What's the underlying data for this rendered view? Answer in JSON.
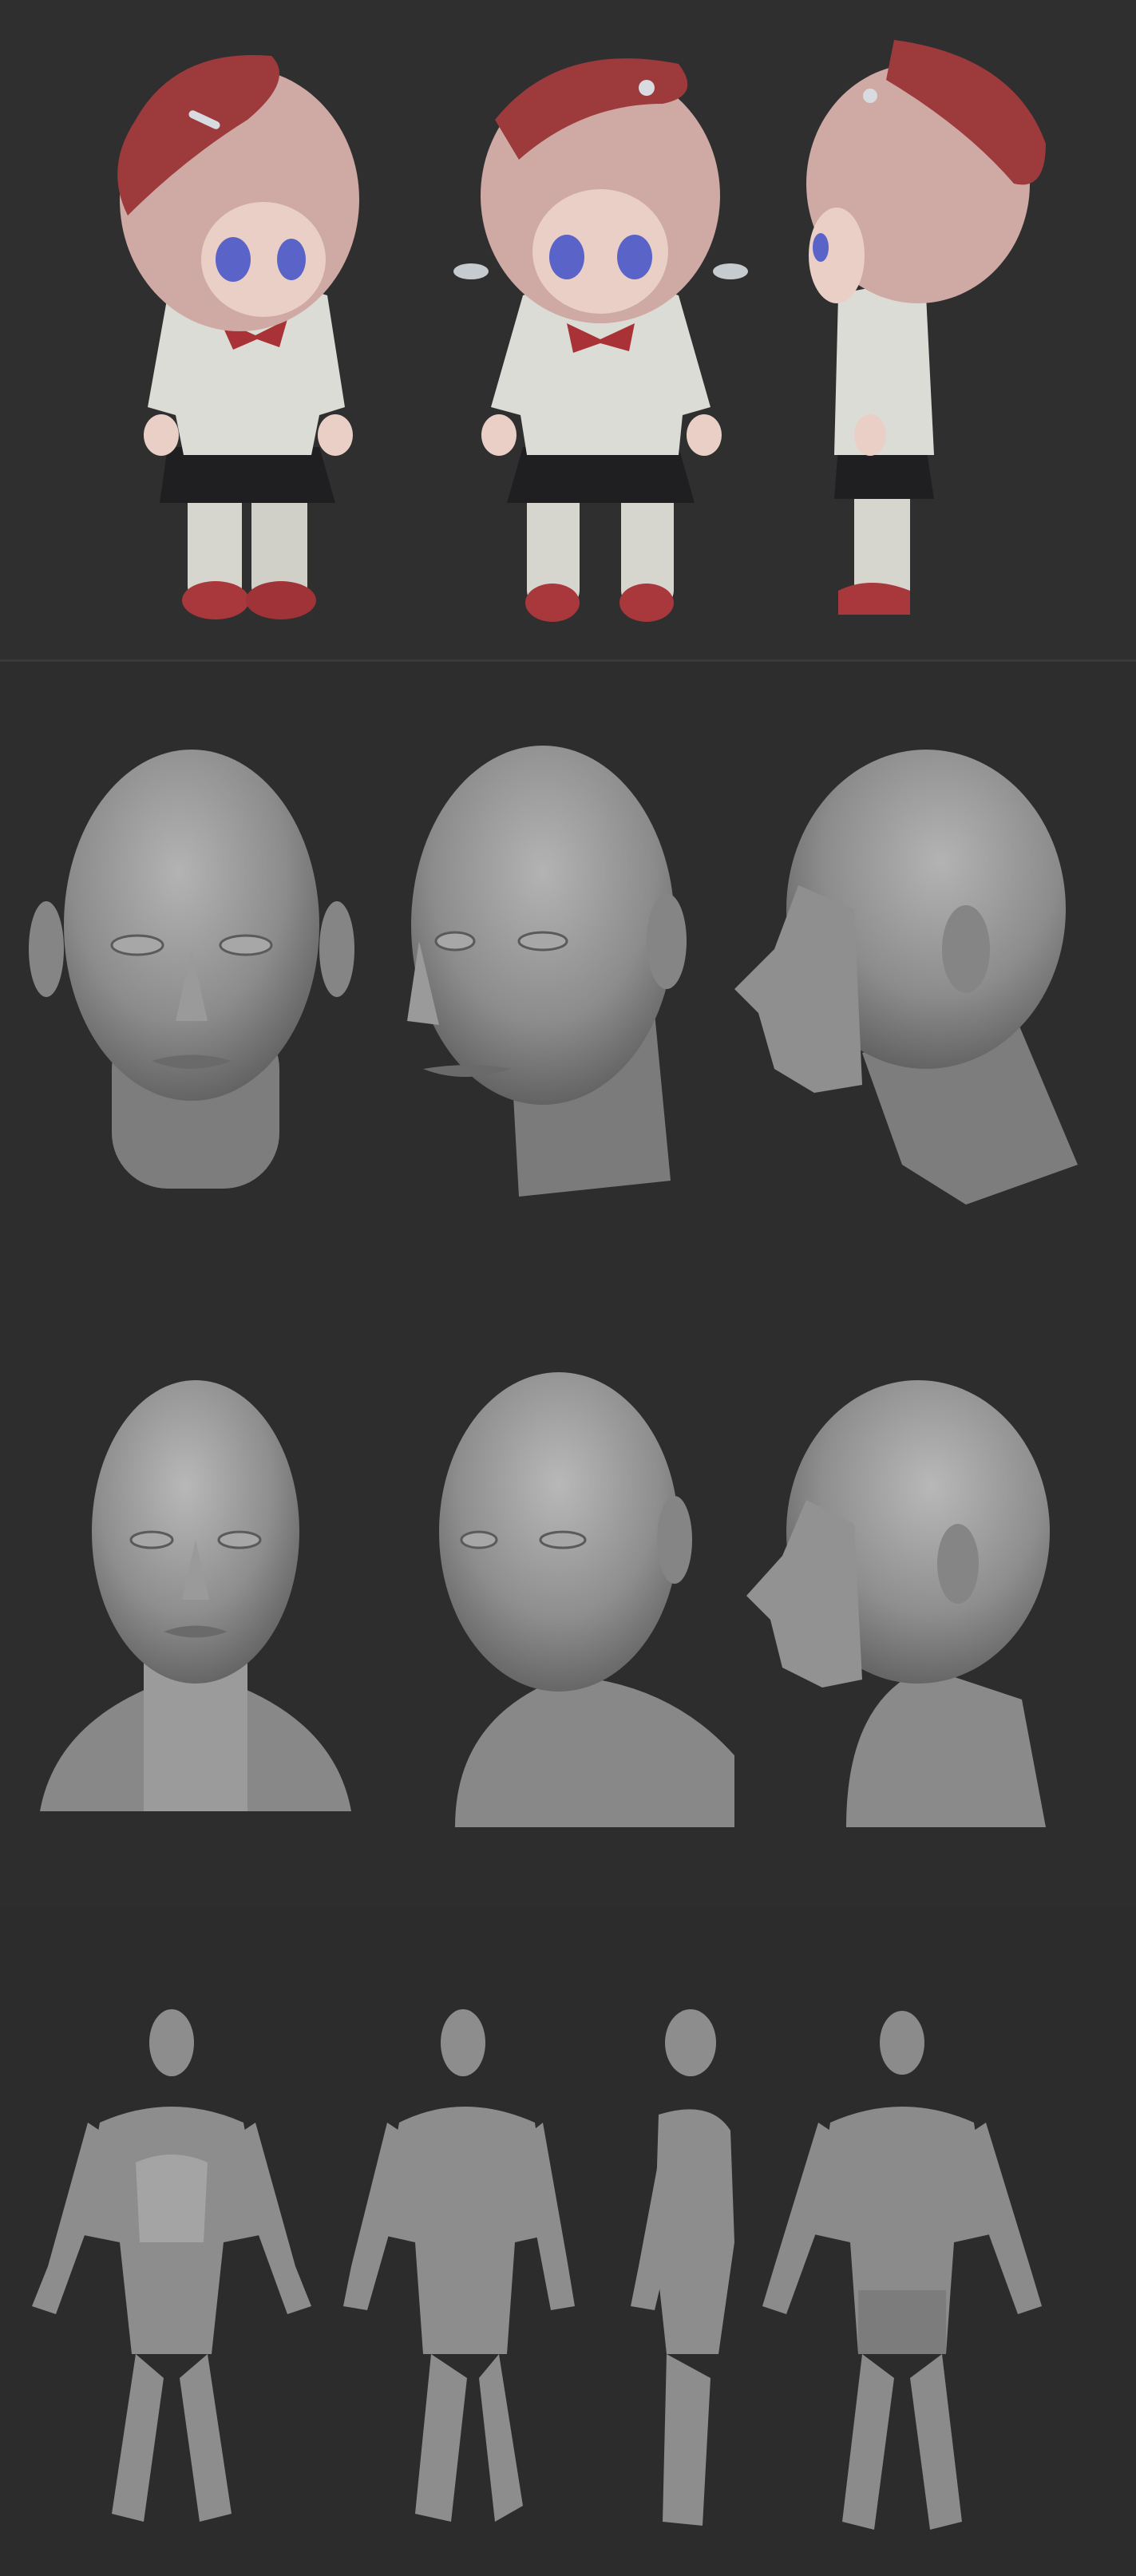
{
  "sheet": {
    "background": "#2e2e2e",
    "clay_color": "#8a8a8a",
    "chibi_colors": {
      "beret": "#9c3a3c",
      "hair": "#cfa9a4",
      "skin": "#e9cfc6",
      "shirt": "#dcdcd6",
      "skirt": "#1f1f22",
      "socks": "#d6d6cf",
      "shoes": "#a8383c",
      "eyes": "#5a63c8",
      "bow": "#a83236",
      "hair_clip": "#d8dbe0"
    }
  },
  "rows": [
    {
      "id": "chibi-girl",
      "views": [
        "front-three-quarter",
        "front",
        "side"
      ]
    },
    {
      "id": "male-head",
      "views": [
        "front",
        "three-quarter",
        "side"
      ]
    },
    {
      "id": "female-bust",
      "views": [
        "front",
        "three-quarter",
        "side"
      ]
    },
    {
      "id": "anatomy-body",
      "views": [
        "front",
        "three-quarter",
        "side",
        "back"
      ]
    }
  ]
}
